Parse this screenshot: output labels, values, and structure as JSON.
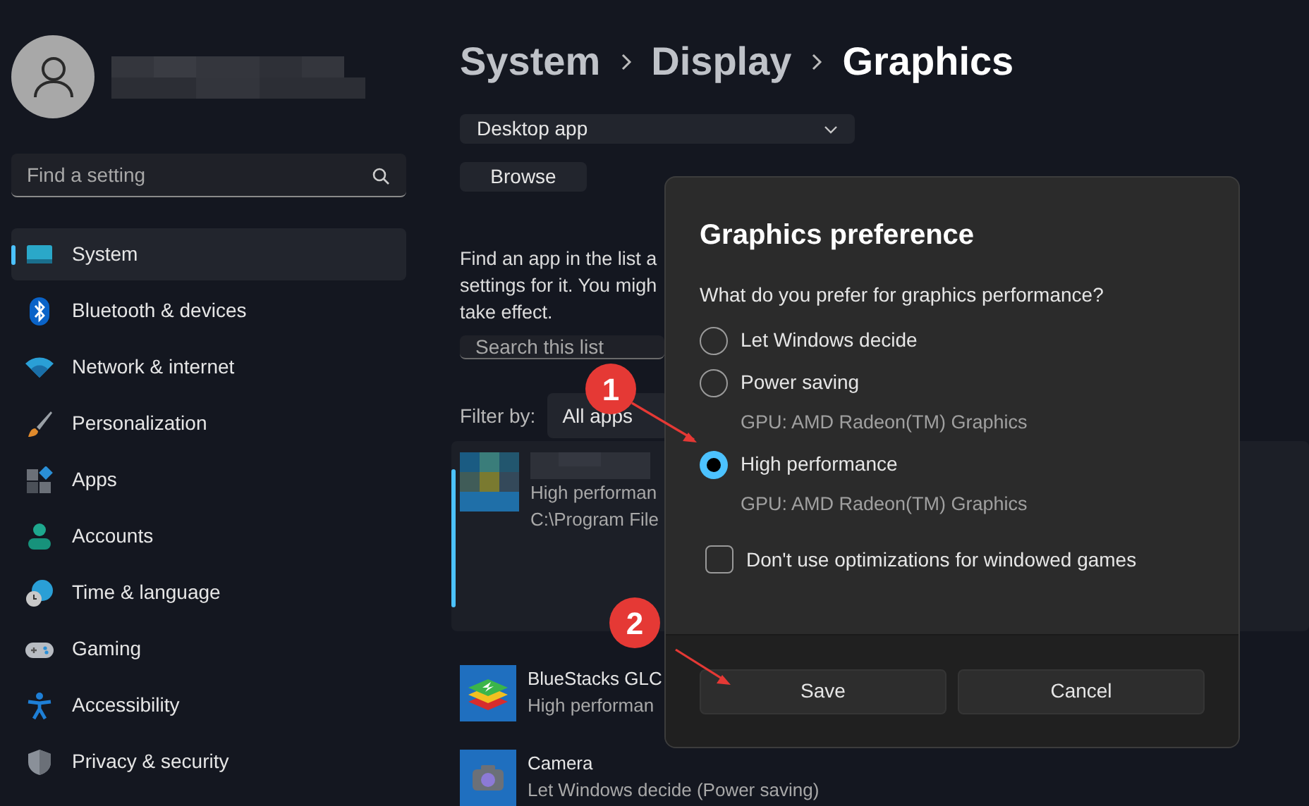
{
  "sidebar": {
    "search": {
      "placeholder": "Find a setting"
    },
    "items": [
      {
        "label": "System",
        "kind": "system",
        "selected": true
      },
      {
        "label": "Bluetooth & devices",
        "kind": "bluetooth",
        "selected": false
      },
      {
        "label": "Network & internet",
        "kind": "wifi",
        "selected": false
      },
      {
        "label": "Personalization",
        "kind": "brush",
        "selected": false
      },
      {
        "label": "Apps",
        "kind": "apps",
        "selected": false
      },
      {
        "label": "Accounts",
        "kind": "person",
        "selected": false
      },
      {
        "label": "Time & language",
        "kind": "globe",
        "selected": false
      },
      {
        "label": "Gaming",
        "kind": "gamepad",
        "selected": false
      },
      {
        "label": "Accessibility",
        "kind": "accessibility",
        "selected": false
      },
      {
        "label": "Privacy & security",
        "kind": "shield",
        "selected": false
      }
    ]
  },
  "breadcrumb": [
    "System",
    "Display",
    "Graphics"
  ],
  "app_type_dropdown": {
    "value": "Desktop app"
  },
  "browse_button": "Browse",
  "description_lines": [
    "Find an app in the list a",
    "settings for it. You migh",
    "take effect."
  ],
  "list_search": {
    "placeholder": "Search this list"
  },
  "filter": {
    "label": "Filter by:",
    "value": "All apps"
  },
  "apps": [
    {
      "kind": "redacted",
      "lines": [
        "High performan",
        "C:\\Program File"
      ],
      "selected": true
    },
    {
      "kind": "bluestacks",
      "title": "BlueStacks GLC",
      "lines": [
        "High performan"
      ],
      "selected": false
    },
    {
      "kind": "camera",
      "title": "Camera",
      "lines": [
        "Let Windows decide (Power saving)"
      ],
      "selected": false
    }
  ],
  "dialog": {
    "title": "Graphics preference",
    "question": "What do you prefer for graphics performance?",
    "options": [
      {
        "label": "Let Windows decide",
        "selected": false
      },
      {
        "label": "Power saving",
        "detail": "GPU: AMD Radeon(TM) Graphics",
        "selected": false
      },
      {
        "label": "High performance",
        "detail": "GPU: AMD Radeon(TM) Graphics",
        "selected": true
      }
    ],
    "checkbox": {
      "label": "Don't use optimizations for windowed games",
      "checked": false
    },
    "buttons": [
      "Save",
      "Cancel"
    ]
  },
  "annotations": [
    "1",
    "2"
  ]
}
